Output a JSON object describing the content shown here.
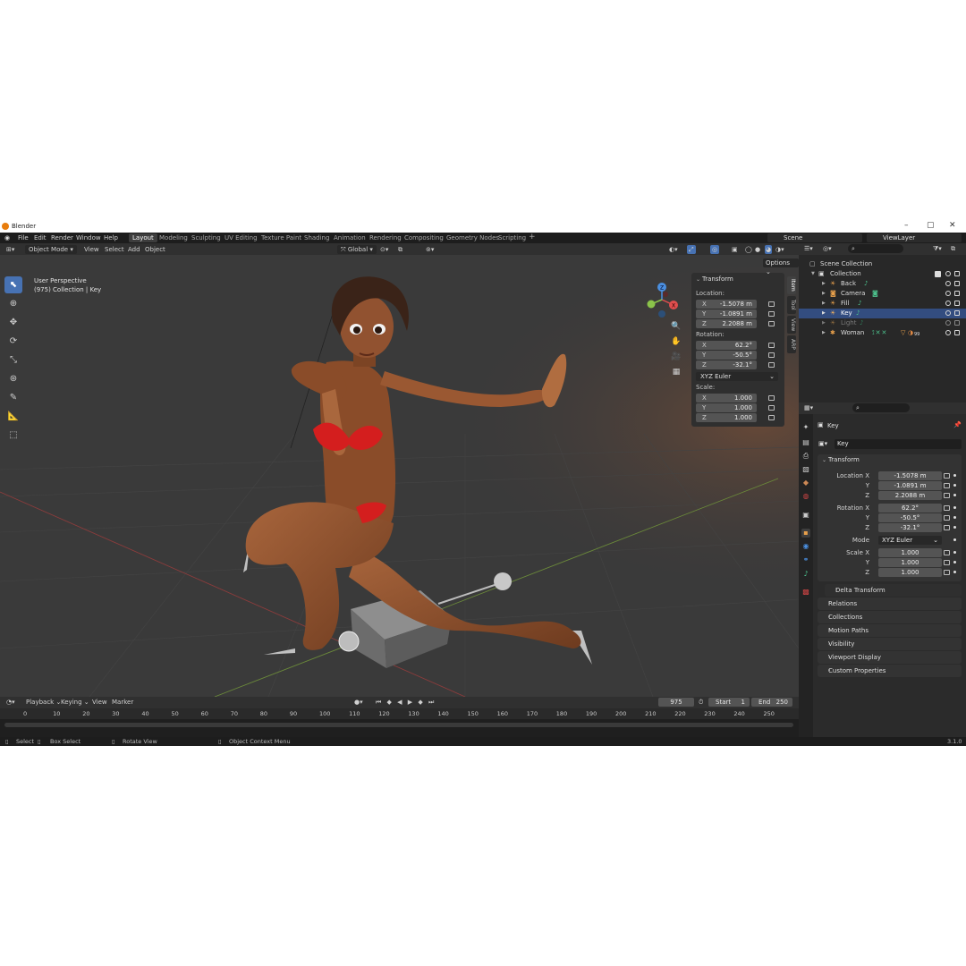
{
  "window": {
    "title": "Blender",
    "version": "3.1.0"
  },
  "menu": [
    "File",
    "Edit",
    "Render",
    "Window",
    "Help"
  ],
  "workspaces": [
    "Layout",
    "Modeling",
    "Sculpting",
    "UV Editing",
    "Texture Paint",
    "Shading",
    "Animation",
    "Rendering",
    "Compositing",
    "Geometry Nodes",
    "Scripting"
  ],
  "active_workspace": "Layout",
  "scene_name": "Scene",
  "view_layer": "ViewLayer",
  "viewport_header": {
    "mode": "Object Mode",
    "menus": [
      "View",
      "Select",
      "Add",
      "Object"
    ],
    "orientation": "Global",
    "options": "Options"
  },
  "viewport": {
    "perspective": "User Perspective",
    "collection_info": "(975) Collection | Key"
  },
  "gizmo": {
    "x": "X",
    "y": "Y",
    "z": "Z"
  },
  "npanel": {
    "header": "Transform",
    "location_label": "Location:",
    "rotation_label": "Rotation:",
    "scale_label": "Scale:",
    "location": [
      {
        "axis": "X",
        "value": "-1.5078 m"
      },
      {
        "axis": "Y",
        "value": "-1.0891 m"
      },
      {
        "axis": "Z",
        "value": "2.2088 m"
      }
    ],
    "rotation": [
      {
        "axis": "X",
        "value": "62.2°"
      },
      {
        "axis": "Y",
        "value": "-50.5°"
      },
      {
        "axis": "Z",
        "value": "-32.1°"
      }
    ],
    "rotation_mode": "XYZ Euler",
    "scale": [
      {
        "axis": "X",
        "value": "1.000"
      },
      {
        "axis": "Y",
        "value": "1.000"
      },
      {
        "axis": "Z",
        "value": "1.000"
      }
    ],
    "tabs": [
      "Item",
      "Tool",
      "View",
      "ARP"
    ]
  },
  "timeline": {
    "menus": [
      "Playback",
      "Keying",
      "View",
      "Marker"
    ],
    "current_frame": "975",
    "start_label": "Start",
    "start": "1",
    "end_label": "End",
    "end": "250",
    "ticks": [
      "0",
      "10",
      "20",
      "30",
      "40",
      "50",
      "60",
      "70",
      "80",
      "90",
      "100",
      "110",
      "120",
      "130",
      "140",
      "150",
      "160",
      "170",
      "180",
      "190",
      "200",
      "210",
      "220",
      "230",
      "240",
      "250"
    ]
  },
  "statusbar": {
    "select": "Select",
    "box_select": "Box Select",
    "rotate_view": "Rotate View",
    "context_menu": "Object Context Menu"
  },
  "outliner": {
    "scene_collection": "Scene Collection",
    "collection": "Collection",
    "items": [
      {
        "name": "Back",
        "icon": "light-icon",
        "color": "#e8a04b"
      },
      {
        "name": "Camera",
        "icon": "camera-icon",
        "color": "#e8a04b"
      },
      {
        "name": "Fill",
        "icon": "light-icon",
        "color": "#e8a04b"
      },
      {
        "name": "Key",
        "icon": "light-icon",
        "color": "#e8a04b"
      },
      {
        "name": "Light",
        "icon": "light-icon",
        "color": "#e8a04b"
      },
      {
        "name": "Woman",
        "icon": "armature-icon",
        "color": "#e8a04b"
      }
    ],
    "woman_badge": "99",
    "selected": "Key"
  },
  "properties": {
    "object_name": "Key",
    "name_field": "Key",
    "transform_header": "Transform",
    "location_x_label": "Location X",
    "rotation_x_label": "Rotation X",
    "mode_label": "Mode",
    "scale_x_label": "Scale X",
    "y_label": "Y",
    "z_label": "Z",
    "location": [
      "-1.5078 m",
      "-1.0891 m",
      "2.2088 m"
    ],
    "rotation": [
      "62.2°",
      "-50.5°",
      "-32.1°"
    ],
    "mode": "XYZ Euler",
    "scale": [
      "1.000",
      "1.000",
      "1.000"
    ],
    "delta_transform": "Delta Transform",
    "panels": [
      "Relations",
      "Collections",
      "Motion Paths",
      "Visibility",
      "Viewport Display",
      "Custom Properties"
    ]
  },
  "colors": {
    "selection": "#4772b3",
    "outliner_selected": "#334d80",
    "object_orange": "#e8a04b",
    "axis_x": "#e04e4e",
    "axis_y": "#8bc34a",
    "axis_z": "#4a8fe0"
  }
}
